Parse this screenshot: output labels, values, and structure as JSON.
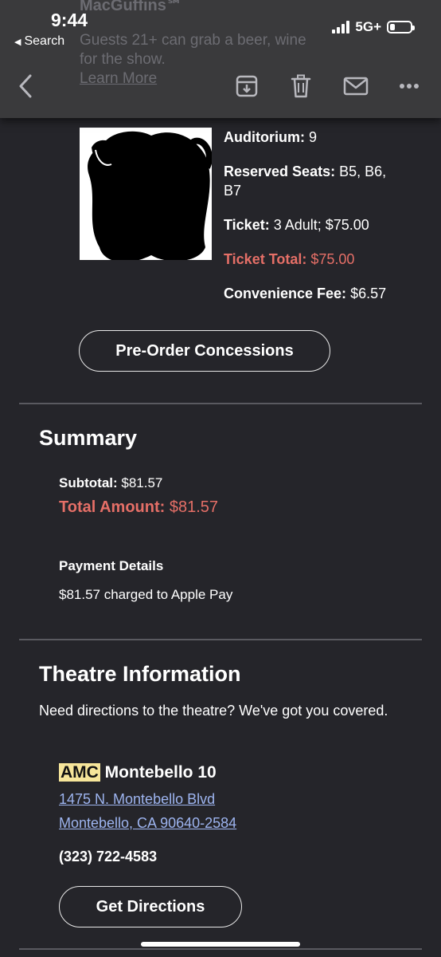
{
  "status_bar": {
    "time": "9:44",
    "back_label": "Search",
    "network": "5G+"
  },
  "ghost_text": {
    "title": "MacGuffins℠",
    "line1": "Guests 21+ can grab a beer, wine",
    "line2": "for the show.",
    "link": "Learn More"
  },
  "toolbar": {
    "icons": [
      "back-chevron-icon",
      "archive-icon",
      "trash-icon",
      "mail-icon",
      "more-icon"
    ]
  },
  "ticket": {
    "auditorium_label": "Auditorium:",
    "auditorium_value": "9",
    "seats_label": "Reserved Seats:",
    "seats_value_line1": "B5, B6,",
    "seats_value_line2": "B7",
    "ticket_label": "Ticket:",
    "ticket_value": "3 Adult; $75.00",
    "ticket_total_label": "Ticket Total:",
    "ticket_total_value": "$75.00",
    "fee_label": "Convenience Fee:",
    "fee_value": "$6.57",
    "preorder_button": "Pre-Order Concessions"
  },
  "summary": {
    "heading": "Summary",
    "subtotal_label": "Subtotal:",
    "subtotal_value": "$81.57",
    "total_label": "Total Amount:",
    "total_value": "$81.57",
    "payment_heading": "Payment Details",
    "payment_text": "$81.57 charged to Apple Pay"
  },
  "theatre": {
    "heading": "Theatre Information",
    "intro": "Need directions to the theatre? We've got you covered.",
    "brand": "AMC",
    "name": "Montebello 10",
    "address_line1": "1475 N. Montebello Blvd",
    "address_line2": "Montebello, CA 90640-2584",
    "phone": "(323) 722-4583",
    "directions_button": "Get Directions"
  },
  "colors": {
    "background": "#25252a",
    "toolbar": "#3a3a3c",
    "accent_red": "#e56f67",
    "link_blue": "#9db4ef",
    "amc_highlight": "#f6e59a"
  }
}
